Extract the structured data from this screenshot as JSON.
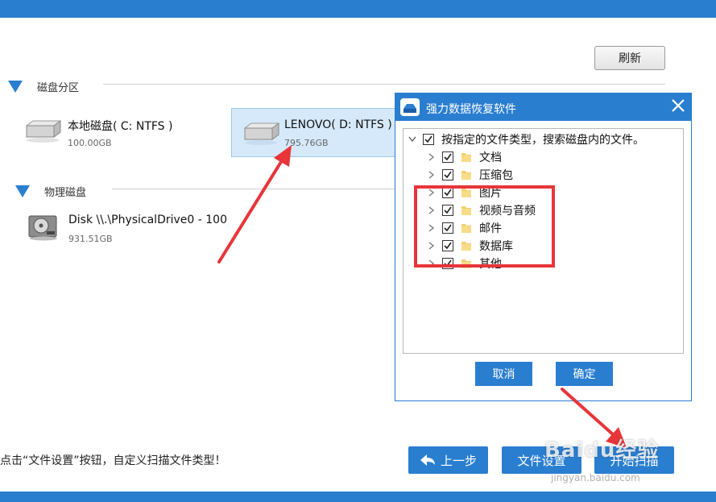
{
  "toolbar": {
    "refresh_label": "刷新"
  },
  "sections": {
    "partitions": {
      "label": "磁盘分区"
    },
    "physical": {
      "label": "物理磁盘"
    }
  },
  "drives": [
    {
      "name": "本地磁盘( C: NTFS )",
      "size": "100.00GB",
      "selected": false
    },
    {
      "name": "LENOVO( D: NTFS )",
      "size": "795.76GB",
      "selected": true
    }
  ],
  "physical_drives": [
    {
      "name": "Disk \\\\.\\PhysicalDrive0 - 100",
      "size": "931.51GB"
    }
  ],
  "footer": {
    "hint": "点击“文件设置”按钮，自定义扫描文件类型！",
    "prev_label": "上一步",
    "file_settings_label": "文件设置",
    "start_label": "开始扫描"
  },
  "dialog": {
    "title": "强力数据恢复软件",
    "root_label": "按指定的文件类型，搜索磁盘内的文件。",
    "items": [
      {
        "label": "文档",
        "checked": true
      },
      {
        "label": "压缩包",
        "checked": true
      },
      {
        "label": "图片",
        "checked": true
      },
      {
        "label": "视频与音频",
        "checked": true
      },
      {
        "label": "邮件",
        "checked": true
      },
      {
        "label": "数据库",
        "checked": true
      },
      {
        "label": "其他",
        "checked": true
      }
    ],
    "cancel_label": "取消",
    "ok_label": "确定"
  },
  "watermark": {
    "logo": "Baidu经验",
    "sub": "jingyan.baidu.com"
  },
  "colors": {
    "accent": "#2a7ed0",
    "annotation": "#e8353a",
    "selection": "#d5e9fa"
  }
}
